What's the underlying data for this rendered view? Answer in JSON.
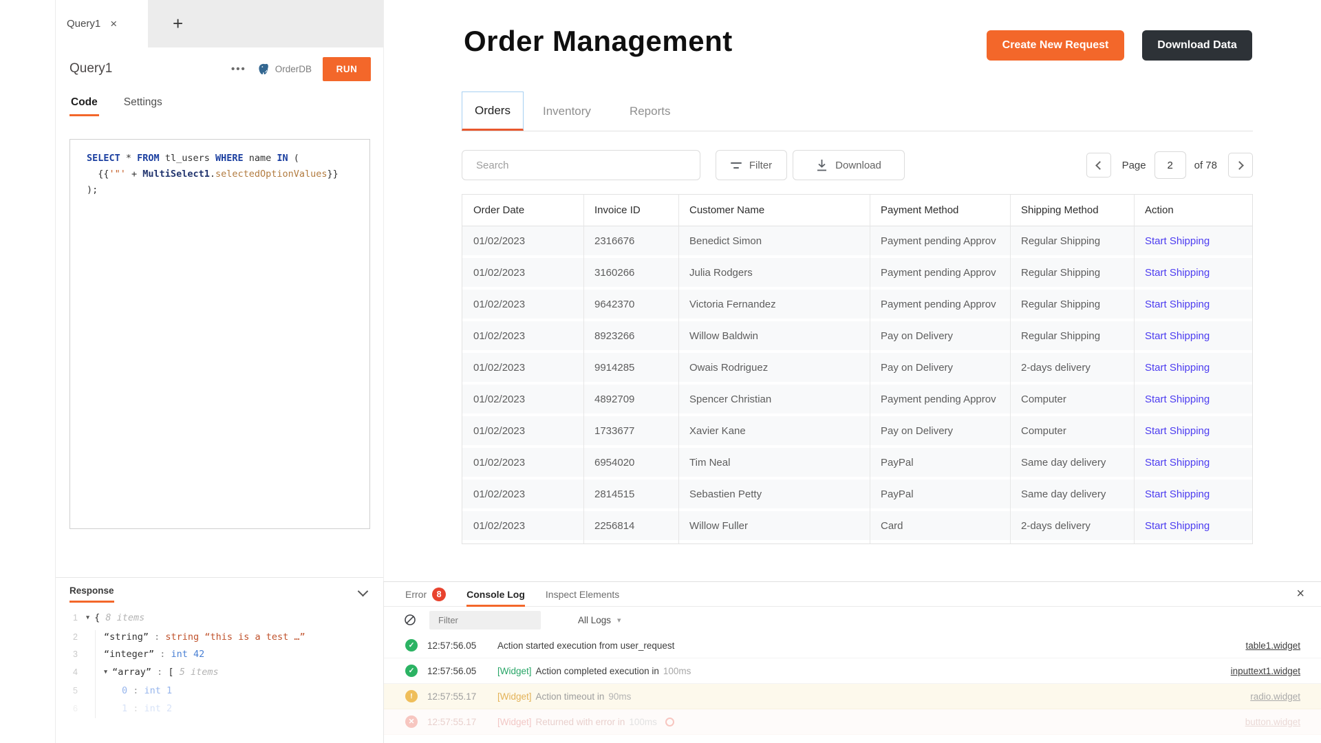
{
  "colors": {
    "accent_orange": "#f3672a",
    "dark_button": "#2d3237",
    "action_link": "#4c3cf0",
    "success_green": "#2bb363",
    "warning_amber": "#edb33e",
    "error_red": "#e8513f",
    "error_badge": "#e8432e",
    "postgres_blue": "#336791",
    "active_tab_border": "#a6cff2"
  },
  "left_panel": {
    "tab_bar": {
      "active_tab": "Query1",
      "close_icon": "×",
      "add_icon": "+"
    },
    "header": {
      "title": "Query1",
      "menu_icon": "•••",
      "datasource": "OrderDB",
      "run_button": "RUN"
    },
    "subtabs": [
      {
        "label": "Code",
        "active": true
      },
      {
        "label": "Settings",
        "active": false
      }
    ],
    "code_lines": [
      {
        "tokens": [
          {
            "t": "SELECT",
            "c": "kw"
          },
          {
            "t": " * ",
            "c": "pl"
          },
          {
            "t": "FROM",
            "c": "kw"
          },
          {
            "t": " tl_users ",
            "c": "pl"
          },
          {
            "t": "WHERE",
            "c": "kw"
          },
          {
            "t": " name ",
            "c": "pl"
          },
          {
            "t": "IN",
            "c": "kw"
          },
          {
            "t": " (",
            "c": "pl"
          }
        ]
      },
      {
        "tokens": [
          {
            "t": "  {{",
            "c": "pl"
          },
          {
            "t": "'\"'",
            "c": "str"
          },
          {
            "t": " + ",
            "c": "pl"
          },
          {
            "t": "MultiSelect1",
            "c": "obj"
          },
          {
            "t": ".",
            "c": "pl"
          },
          {
            "t": "selectedOptionValues",
            "c": "prop"
          },
          {
            "t": "}}",
            "c": "pl"
          }
        ]
      },
      {
        "tokens": [
          {
            "t": ");",
            "c": "pl"
          }
        ]
      }
    ],
    "response": {
      "title": "Response",
      "arrow_icon": "▼",
      "lines": [
        {
          "num": "1",
          "indent": 0,
          "arrow": true,
          "opacity": 1,
          "tokens": [
            {
              "t": "{ ",
              "c": "key"
            },
            {
              "t": "8 items",
              "c": "meta"
            }
          ]
        },
        {
          "num": "2",
          "indent": 1,
          "arrow": false,
          "opacity": 1,
          "tokens": [
            {
              "t": "“string”",
              "c": "key"
            },
            {
              "t": " : ",
              "c": "sep"
            },
            {
              "t": "string “this is a test …”",
              "c": "jstr"
            }
          ]
        },
        {
          "num": "3",
          "indent": 1,
          "arrow": false,
          "opacity": 1,
          "tokens": [
            {
              "t": "“integer”",
              "c": "key"
            },
            {
              "t": " : ",
              "c": "sep"
            },
            {
              "t": "int 42",
              "c": "int"
            }
          ]
        },
        {
          "num": "4",
          "indent": 1,
          "arrow": true,
          "opacity": 1,
          "tokens": [
            {
              "t": "“array”",
              "c": "key"
            },
            {
              "t": " : ",
              "c": "sep"
            },
            {
              "t": "[ ",
              "c": "key"
            },
            {
              "t": "5 items",
              "c": "meta"
            }
          ]
        },
        {
          "num": "5",
          "indent": 2,
          "arrow": false,
          "opacity": 0.8,
          "tokens": [
            {
              "t": "0",
              "c": "int2"
            },
            {
              "t": " : ",
              "c": "sep"
            },
            {
              "t": "int 1",
              "c": "int2"
            }
          ]
        },
        {
          "num": "6",
          "indent": 2,
          "arrow": false,
          "opacity": 0.3,
          "tokens": [
            {
              "t": "1",
              "c": "int2"
            },
            {
              "t": " : ",
              "c": "sep"
            },
            {
              "t": "int 2",
              "c": "int2"
            }
          ]
        }
      ]
    }
  },
  "app": {
    "title": "Order Management",
    "buttons": {
      "create": "Create New Request",
      "download": "Download Data"
    },
    "tabs": [
      {
        "label": "Orders",
        "active": true
      },
      {
        "label": "Inventory",
        "active": false
      },
      {
        "label": "Reports",
        "active": false
      }
    ],
    "toolbar": {
      "search_placeholder": "Search",
      "filter_label": "Filter",
      "download_label": "Download"
    },
    "pagination": {
      "page_label": "Page",
      "current": "2",
      "of_label": "of 78"
    },
    "table": {
      "headers": [
        "Order Date",
        "Invoice ID",
        "Customer Name",
        "Payment Method",
        "Shipping Method",
        "Action"
      ],
      "rows": [
        {
          "order_date": "01/02/2023",
          "invoice_id": "2316676",
          "customer": "Benedict Simon",
          "payment": "Payment pending Approv",
          "shipping": "Regular Shipping",
          "action": "Start Shipping"
        },
        {
          "order_date": "01/02/2023",
          "invoice_id": "3160266",
          "customer": "Julia Rodgers",
          "payment": "Payment pending Approv",
          "shipping": "Regular Shipping",
          "action": "Start Shipping"
        },
        {
          "order_date": "01/02/2023",
          "invoice_id": "9642370",
          "customer": "Victoria Fernandez",
          "payment": "Payment pending Approv",
          "shipping": "Regular Shipping",
          "action": "Start Shipping"
        },
        {
          "order_date": "01/02/2023",
          "invoice_id": "8923266",
          "customer": "Willow Baldwin",
          "payment": "Pay on Delivery",
          "shipping": "Regular Shipping",
          "action": "Start Shipping"
        },
        {
          "order_date": "01/02/2023",
          "invoice_id": "9914285",
          "customer": "Owais Rodriguez",
          "payment": "Pay on Delivery",
          "shipping": "2-days delivery",
          "action": "Start Shipping"
        },
        {
          "order_date": "01/02/2023",
          "invoice_id": "4892709",
          "customer": "Spencer Christian",
          "payment": "Payment pending Approv",
          "shipping": "Computer",
          "action": "Start Shipping"
        },
        {
          "order_date": "01/02/2023",
          "invoice_id": "1733677",
          "customer": "Xavier Kane",
          "payment": "Pay on Delivery",
          "shipping": "Computer",
          "action": "Start Shipping"
        },
        {
          "order_date": "01/02/2023",
          "invoice_id": "6954020",
          "customer": "Tim Neal",
          "payment": "PayPal",
          "shipping": "Same day delivery",
          "action": "Start Shipping"
        },
        {
          "order_date": "01/02/2023",
          "invoice_id": "2814515",
          "customer": "Sebastien Petty",
          "payment": "PayPal",
          "shipping": "Same day delivery",
          "action": "Start Shipping"
        },
        {
          "order_date": "01/02/2023",
          "invoice_id": "2256814",
          "customer": "Willow Fuller",
          "payment": "Card",
          "shipping": "2-days delivery",
          "action": "Start Shipping"
        }
      ]
    }
  },
  "console": {
    "error_tab": {
      "label": "Error",
      "count": "8"
    },
    "tabs": [
      {
        "label": "Console Log",
        "active": true
      },
      {
        "label": "Inspect Elements",
        "active": false
      }
    ],
    "close_icon": "×",
    "filter_placeholder": "Filter",
    "logs_filter": "All Logs",
    "caret_icon": "▾",
    "level_icons": {
      "success": "✓",
      "warning": "!",
      "error": "✕"
    },
    "logs": [
      {
        "level": "success",
        "time": "12:57:56.05",
        "tag": "",
        "message": "Action started execution from user_request",
        "duration": "",
        "link": "table1.widget",
        "opacity": 1
      },
      {
        "level": "success",
        "time": "12:57:56.05",
        "tag": "[Widget]",
        "message": "Action completed execution in",
        "duration": "100ms",
        "link": "inputtext1.widget",
        "opacity": 1
      },
      {
        "level": "warning",
        "time": "12:57:55.17",
        "tag": "[Widget]",
        "message": "Action timeout in",
        "duration": "90ms",
        "link": "radio.widget",
        "opacity": 0.85
      },
      {
        "level": "error",
        "time": "12:57:55.17",
        "tag": "[Widget]",
        "message": "Returned with error in",
        "duration": "100ms",
        "link": "button.widget",
        "opacity": 0.32
      }
    ]
  }
}
